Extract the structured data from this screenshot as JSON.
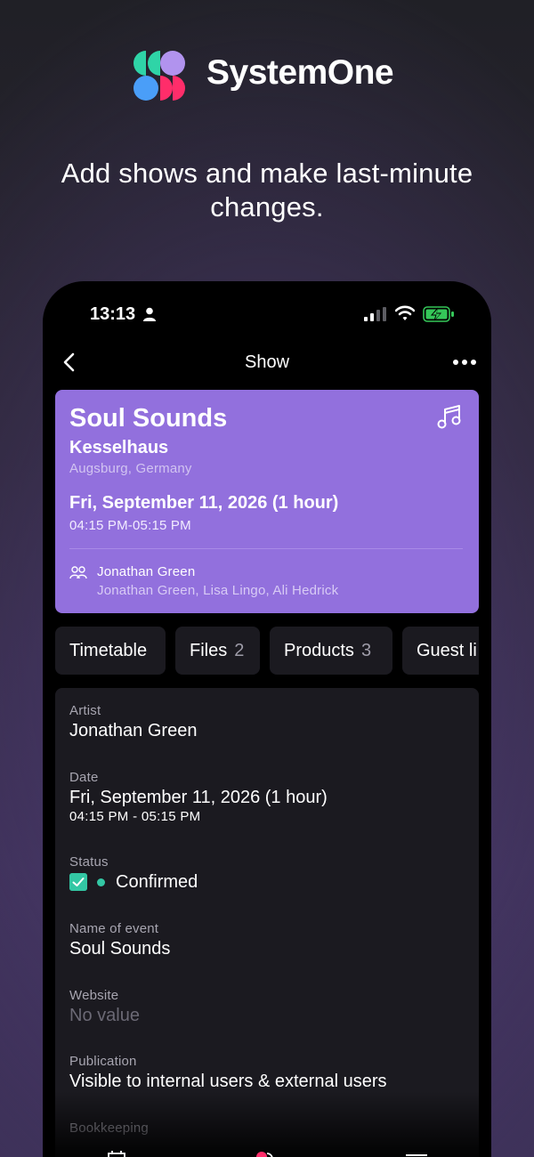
{
  "brand": {
    "name": "SystemOne",
    "tagline": "Add shows and make last-minute changes."
  },
  "status_bar": {
    "time": "13:13"
  },
  "nav": {
    "title": "Show"
  },
  "show": {
    "title": "Soul Sounds",
    "venue": "Kesselhaus",
    "location": "Augsburg, Germany",
    "date": "Fri, September 11, 2026 (1 hour)",
    "time": "04:15 PM-05:15 PM",
    "contact": "Jonathan Green",
    "members": "Jonathan Green, Lisa Lingo, Ali Hedrick"
  },
  "tabs": [
    {
      "label": "Timetable",
      "count": ""
    },
    {
      "label": "Files",
      "count": "2"
    },
    {
      "label": "Products",
      "count": "3"
    },
    {
      "label": "Guest li",
      "count": ""
    }
  ],
  "details": {
    "artist": {
      "label": "Artist",
      "value": "Jonathan Green"
    },
    "date": {
      "label": "Date",
      "value": "Fri, September 11, 2026 (1 hour)",
      "sub": "04:15 PM - 05:15 PM"
    },
    "status": {
      "label": "Status",
      "value": "Confirmed",
      "checked": true
    },
    "event_name": {
      "label": "Name of event",
      "value": "Soul Sounds"
    },
    "website": {
      "label": "Website",
      "value": "No value"
    },
    "publication": {
      "label": "Publication",
      "value": "Visible to internal users & external users"
    },
    "bookkeeping": {
      "label": "Bookkeeping"
    }
  },
  "colors": {
    "card_accent": "#9270dd",
    "status_green": "#33c7a4",
    "logo_teal": "#2fd4a7",
    "logo_purple": "#b193ee",
    "logo_blue": "#4a9ef8",
    "logo_pink": "#ff2d6a"
  },
  "icons": [
    "person-icon",
    "signal-icon",
    "wifi-icon",
    "battery-icon",
    "back-chevron-icon",
    "more-icon",
    "music-note-icon",
    "group-icon",
    "checkbox-icon",
    "calendar-icon"
  ]
}
